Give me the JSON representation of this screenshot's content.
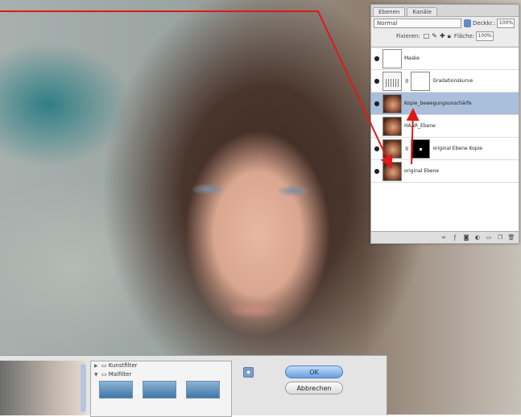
{
  "layers_panel": {
    "tabs": [
      "Ebenen",
      "Kanäle"
    ],
    "blend_mode": "Normal",
    "opacity_label": "Deckkr.:",
    "opacity_value": "100%",
    "lock_label": "Fixieren:",
    "fill_label": "Fläche:",
    "fill_value": "100%",
    "layers": [
      {
        "name": "Maske",
        "thumb": "white",
        "visible": true,
        "selected": false
      },
      {
        "name": "Gradationskurve",
        "thumb": "levels",
        "visible": true,
        "selected": false
      },
      {
        "name": "Kopie_bewegungsunschärfe",
        "thumb": "face",
        "visible": true,
        "selected": true
      },
      {
        "name": "HAAR_Ebene",
        "thumb": "face",
        "visible": false,
        "selected": false
      },
      {
        "name": "original Ebene Kopie",
        "thumb": "face",
        "visible": true,
        "selected": false
      },
      {
        "name": "original Ebene",
        "thumb": "face",
        "visible": true,
        "selected": false
      }
    ]
  },
  "filter_dialog": {
    "filter_groups": [
      "Kunstfilter",
      "Malfilter"
    ],
    "ok_label": "OK",
    "cancel_label": "Abbrechen"
  },
  "colors": {
    "annotation_arrow": "#e01818",
    "selected_layer": "#a9bfdc",
    "ok_button": "#6a9fe0"
  }
}
